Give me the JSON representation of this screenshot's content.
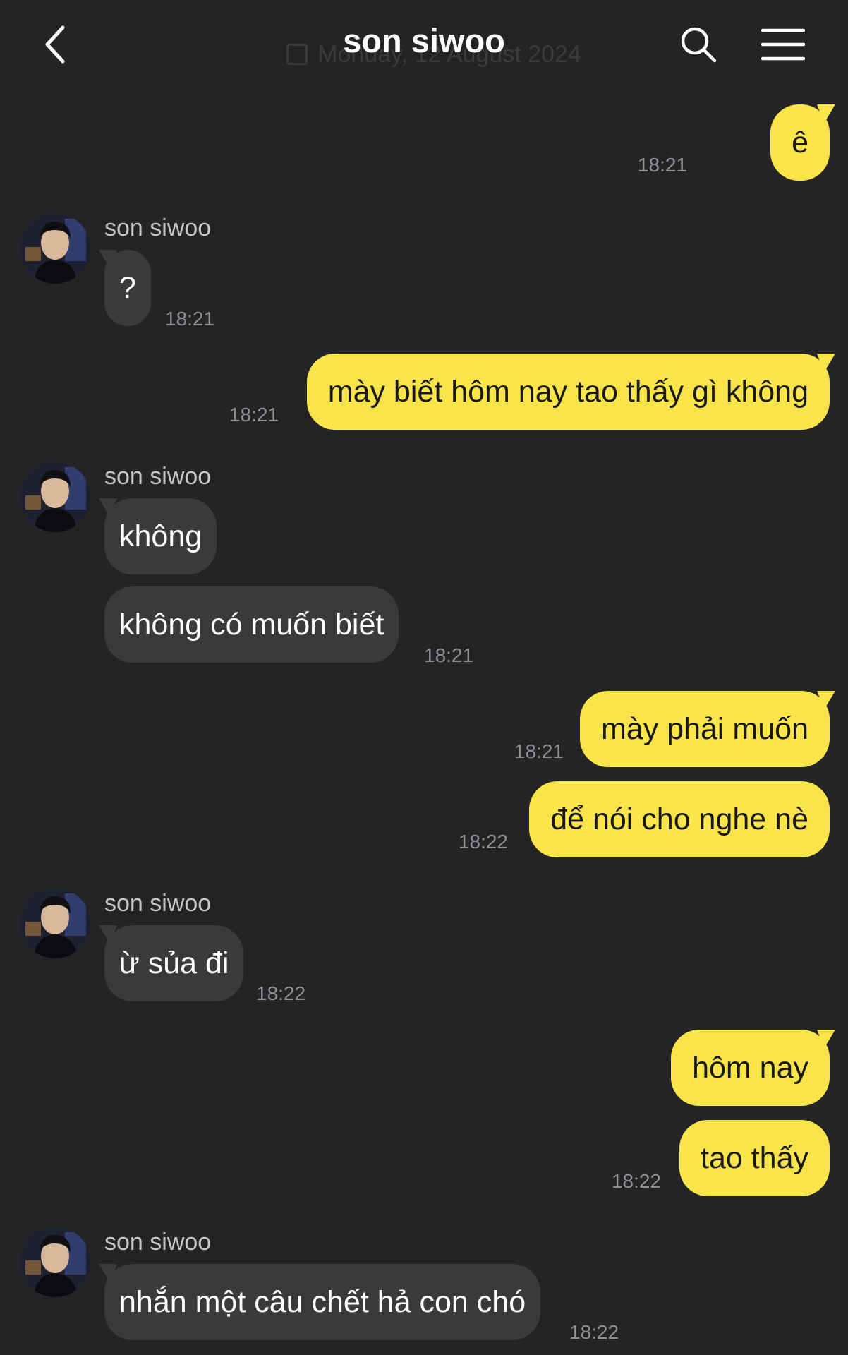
{
  "header": {
    "title": "son siwoo",
    "date_ghost": "Monday, 12 August 2024",
    "icons": {
      "back": "chevron-left-icon",
      "search": "search-icon",
      "menu": "hamburger-menu-icon"
    }
  },
  "colors": {
    "background": "#242426",
    "outgoing_bubble": "#f9e54a",
    "incoming_bubble": "#3a3a3c",
    "timestamp": "#8e8e93"
  },
  "messages": [
    {
      "dir": "out",
      "text": "ê",
      "time": "18:21"
    },
    {
      "dir": "in",
      "sender": "son siwoo",
      "text": "?",
      "time": "18:21"
    },
    {
      "dir": "out",
      "text": "mày biết hôm nay tao thấy gì không",
      "time": "18:21"
    },
    {
      "dir": "in",
      "sender": "son siwoo",
      "text": "không"
    },
    {
      "dir": "in",
      "text": "không có muốn biết",
      "time": "18:21"
    },
    {
      "dir": "out",
      "text": "mày phải muốn",
      "time": "18:21"
    },
    {
      "dir": "out",
      "text": "để nói cho nghe nè",
      "time": "18:22"
    },
    {
      "dir": "in",
      "sender": "son siwoo",
      "text": "ừ sủa đi",
      "time": "18:22"
    },
    {
      "dir": "out",
      "text": "hôm nay"
    },
    {
      "dir": "out",
      "text": "tao thấy",
      "time": "18:22"
    },
    {
      "dir": "in",
      "sender": "son siwoo",
      "text": "nhắn một câu chết hả con chó",
      "time": "18:22"
    }
  ]
}
